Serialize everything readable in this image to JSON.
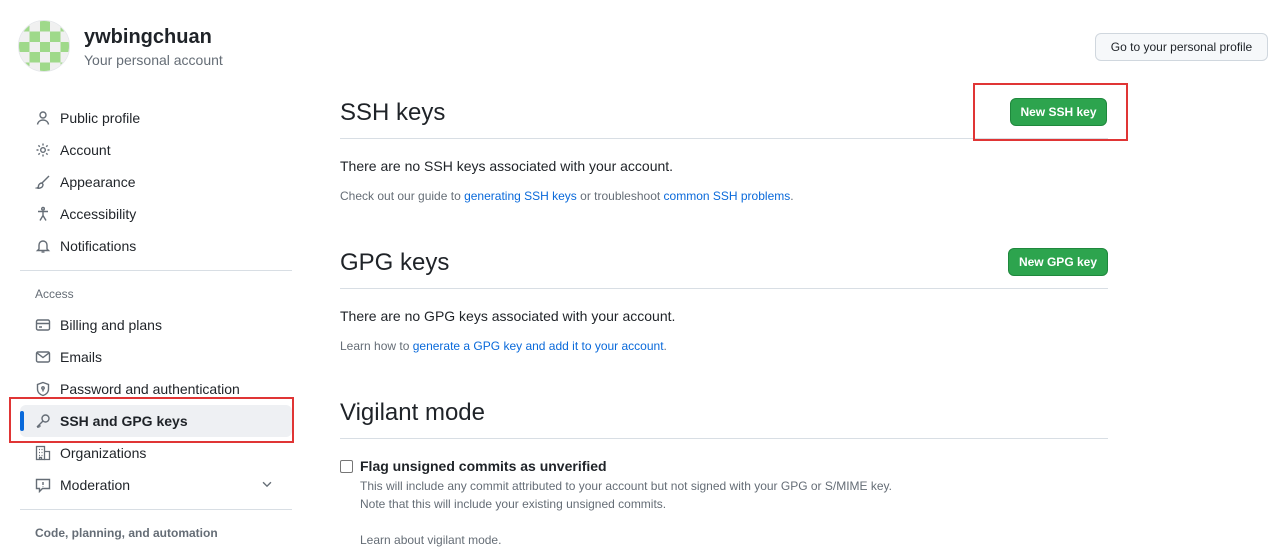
{
  "account": {
    "username": "ywbingchuan",
    "subtitle": "Your personal account",
    "profile_button": "Go to your personal profile"
  },
  "sidebar": {
    "items_top": [
      {
        "label": "Public profile",
        "icon": "person-icon"
      },
      {
        "label": "Account",
        "icon": "gear-icon"
      },
      {
        "label": "Appearance",
        "icon": "paintbrush-icon"
      },
      {
        "label": "Accessibility",
        "icon": "accessibility-icon"
      },
      {
        "label": "Notifications",
        "icon": "bell-icon"
      }
    ],
    "access_heading": "Access",
    "items_access": [
      {
        "label": "Billing and plans",
        "icon": "credit-card-icon"
      },
      {
        "label": "Emails",
        "icon": "mail-icon"
      },
      {
        "label": "Password and authentication",
        "icon": "shield-lock-icon"
      },
      {
        "label": "SSH and GPG keys",
        "icon": "key-icon",
        "active": true
      },
      {
        "label": "Organizations",
        "icon": "organization-icon"
      },
      {
        "label": "Moderation",
        "icon": "report-icon"
      }
    ],
    "code_heading": "Code, planning, and automation"
  },
  "ssh": {
    "title": "SSH keys",
    "button": "New SSH key",
    "empty": "There are no SSH keys associated with your account.",
    "guide_prefix": "Check out our guide to ",
    "guide_link": "generating SSH keys",
    "guide_mid": " or troubleshoot ",
    "guide_link2": "common SSH problems",
    "guide_suffix": "."
  },
  "gpg": {
    "title": "GPG keys",
    "button": "New GPG key",
    "empty": "There are no GPG keys associated with your account.",
    "learn_prefix": "Learn how to ",
    "learn_link": "generate a GPG key and add it to your account",
    "learn_suffix": "."
  },
  "vigilant": {
    "title": "Vigilant mode",
    "checkbox_label": "Flag unsigned commits as unverified",
    "checked": false,
    "desc1": "This will include any commit attributed to your account but not signed with your GPG or S/MIME key.",
    "desc2": "Note that this will include your existing unsigned commits.",
    "learn_link": "Learn about vigilant mode."
  },
  "colors": {
    "accent": "#0969da",
    "green_button": "#2da44e",
    "highlight": "#e03535"
  }
}
